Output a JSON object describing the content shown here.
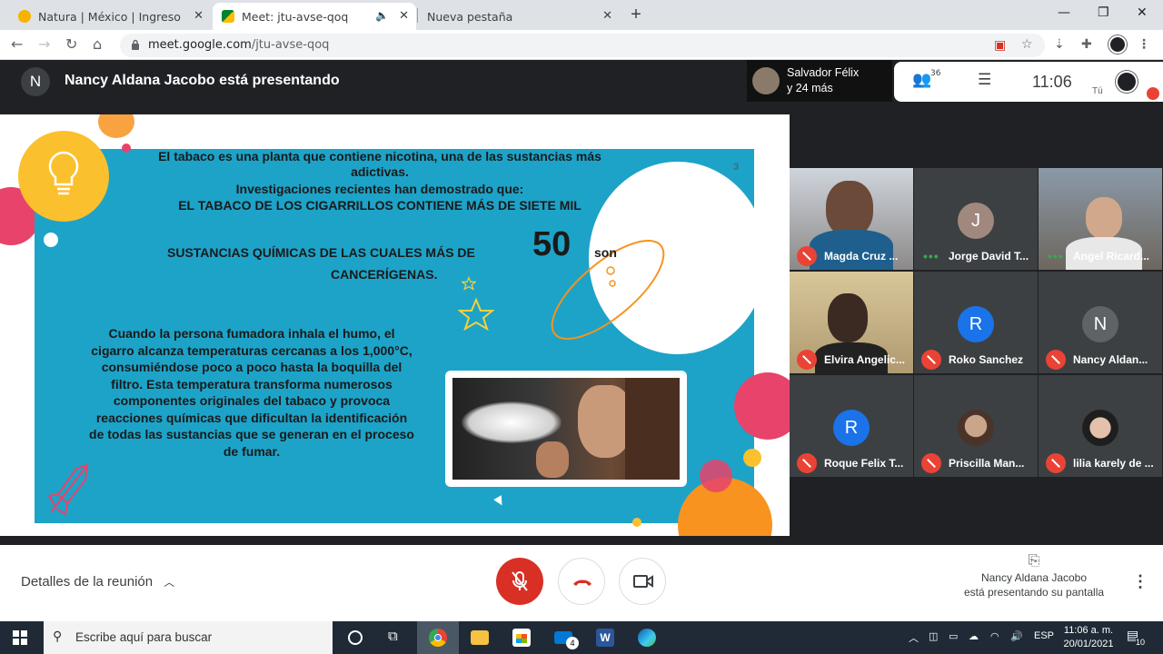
{
  "browser": {
    "tabs": [
      {
        "title": "Natura | México | Ingreso",
        "close": "✕"
      },
      {
        "title": "Meet: jtu-avse-qoq",
        "close": "✕"
      },
      {
        "title": "Nueva pestaña",
        "close": "✕"
      }
    ],
    "new_tab": "+",
    "window_controls": [
      "—",
      "❐",
      "✕"
    ],
    "url_host": "meet.google.com",
    "url_path": "/jtu-avse-qoq"
  },
  "meet": {
    "presenter_initial": "N",
    "presenting_text": "Nancy Aldana Jacobo está presentando",
    "others_line1": "Salvador Félix",
    "others_line2": "y 24 más",
    "participants_count": "36",
    "time": "11:06",
    "you_label": "Tú"
  },
  "slide": {
    "page": "3",
    "p1_l1": "El tabaco es una planta que contiene nicotina, una de las sustancias más",
    "p1_l2": "adictivas.",
    "p1_l3": "Investigaciones recientes han demostrado que:",
    "p1_l4": "EL TABACO DE  LOS CIGARRILLOS CONTIENE MÁS DE SIETE MIL",
    "p1_l5a": "SUSTANCIAS QUÍMICAS DE LAS CUALES MÁS DE",
    "p1_num": "50",
    "p1_l5b": "son",
    "p1_l6": "CANCERÍGENAS.",
    "p2": [
      "Cuando la persona fumadora inhala el humo, el",
      "cigarro alcanza temperaturas cercanas a los 1,000°C,",
      "consumiéndose poco a poco hasta la boquilla del",
      "filtro. Esta temperatura transforma numerosos",
      "componentes originales del tabaco y provoca",
      "reacciones químicas que dificultan la identificación",
      "de todas las sustancias que se generan en el proceso",
      "de fumar."
    ]
  },
  "participants": [
    {
      "name": "Magda Cruz ...",
      "initial": "",
      "muted": true
    },
    {
      "name": "Jorge David T...",
      "initial": "J",
      "color": "#a1887f",
      "muted": false
    },
    {
      "name": "Angel Ricard...",
      "initial": "",
      "muted": false
    },
    {
      "name": "Elvira Angelic...",
      "initial": "",
      "muted": true
    },
    {
      "name": "Roko Sanchez",
      "initial": "R",
      "color": "#1a73e8",
      "muted": true
    },
    {
      "name": "Nancy Aldan...",
      "initial": "N",
      "color": "#5f6368",
      "muted": true
    },
    {
      "name": "Roque Felix T...",
      "initial": "R",
      "color": "#1a73e8",
      "muted": true
    },
    {
      "name": "Priscilla Man...",
      "initial": "",
      "muted": true
    },
    {
      "name": "lilia karely de ...",
      "initial": "",
      "muted": true
    }
  ],
  "controls": {
    "details": "Detalles de la reunión",
    "presenting_line1": "Nancy Aldana Jacobo",
    "presenting_line2": "está presentando su pantalla"
  },
  "taskbar": {
    "search_placeholder": "Escribe aquí para buscar",
    "mail_badge": "4",
    "lang": "ESP",
    "time": "11:06 a. m.",
    "date": "20/01/2021",
    "notif_count": "10"
  }
}
